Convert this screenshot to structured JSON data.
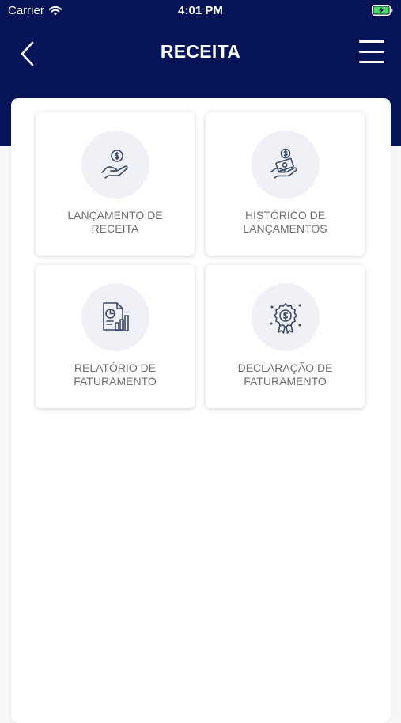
{
  "status_bar": {
    "carrier": "Carrier",
    "time": "4:01 PM"
  },
  "header": {
    "title": "RECEITA",
    "background_color": "#051357"
  },
  "cards": [
    {
      "line1": "LANÇAMENTO DE",
      "line2": "RECEITA",
      "icon": "hand-coin-icon"
    },
    {
      "line1": "HISTÓRICO DE",
      "line2": "LANÇAMENTOS",
      "icon": "money-history-icon"
    },
    {
      "line1": "RELATÓRIO DE",
      "line2": "FATURAMENTO",
      "icon": "report-chart-icon"
    },
    {
      "line1": "DECLARAÇÃO DE",
      "line2": "FATURAMENTO",
      "icon": "award-badge-icon"
    }
  ]
}
